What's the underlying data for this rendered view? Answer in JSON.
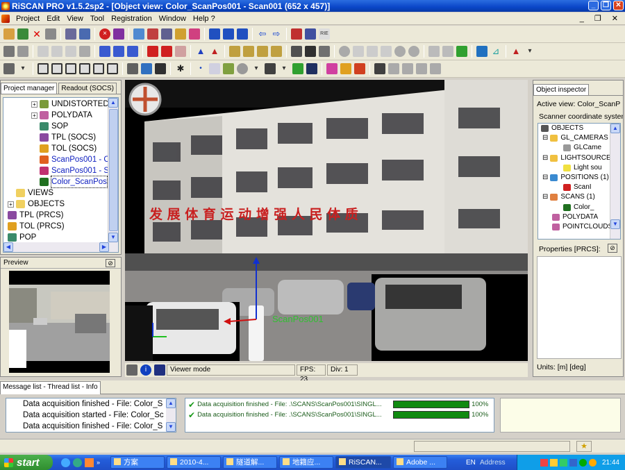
{
  "title": "RiSCAN PRO v1.5.2sp2 - [Object view: Color_ScanPos001 - Scan001 (652 x 457)]",
  "menu": [
    "Project",
    "Edit",
    "View",
    "Tool",
    "Registration",
    "Window",
    "Help ?"
  ],
  "left_panel": {
    "tabs": [
      "Project manager",
      "Readout (SOCS)"
    ],
    "tree": [
      {
        "label": "UNDISTORTED",
        "color": "#000",
        "icon": "#7a9a3a",
        "indent": 40,
        "expand": "+"
      },
      {
        "label": "POLYDATA",
        "color": "#000",
        "icon": "#c060a0",
        "indent": 40,
        "expand": "+"
      },
      {
        "label": "SOP",
        "color": "#000",
        "icon": "#3a8a6a",
        "indent": 52,
        "expand": ""
      },
      {
        "label": "TPL (SOCS)",
        "color": "#000",
        "icon": "#8a4aa0",
        "indent": 52,
        "expand": ""
      },
      {
        "label": "TOL (SOCS)",
        "color": "#000",
        "icon": "#e0a020",
        "indent": 52,
        "expand": ""
      },
      {
        "label": "ScanPos001 - C",
        "color": "#1020c0",
        "icon": "#e06020",
        "indent": 52,
        "expand": ""
      },
      {
        "label": "ScanPos001 - S",
        "color": "#1020c0",
        "icon": "#c03070",
        "indent": 52,
        "expand": ""
      },
      {
        "label": "Color_ScanPos",
        "color": "#1020c0",
        "icon": "#207020",
        "indent": 52,
        "expand": "",
        "selected": true
      },
      {
        "label": "VIEWS",
        "color": "#000",
        "icon": "#f0d060",
        "indent": 18,
        "expand": ""
      },
      {
        "label": "OBJECTS",
        "color": "#000",
        "icon": "#f0d060",
        "indent": 6,
        "expand": "+"
      },
      {
        "label": "TPL (PRCS)",
        "color": "#000",
        "icon": "#8a4aa0",
        "indent": 6,
        "expand": ""
      },
      {
        "label": "TOL (PRCS)",
        "color": "#000",
        "icon": "#e0a020",
        "indent": 6,
        "expand": ""
      },
      {
        "label": "POP",
        "color": "#000",
        "icon": "#3a8a6a",
        "indent": 6,
        "expand": ""
      }
    ],
    "preview_label": "Preview"
  },
  "viewport": {
    "banner_text": "发 展 体 育 运 动   增 强 人 民 体 质",
    "scanpos_label": "ScanPos001"
  },
  "viewer_status": {
    "mode": "Viewer mode",
    "fps": "FPS: 23",
    "div": "Div: 1"
  },
  "right_panel": {
    "tab": "Object inspector",
    "active_view": "Active view:  Color_ScanP",
    "coord_system": "Scanner coordinate system",
    "tree": [
      {
        "label": "OBJECTS",
        "indent": 4,
        "expand": "",
        "icon": "#555"
      },
      {
        "label": "GL_CAMERAS (",
        "indent": 6,
        "expand": "⊟",
        "icon": "#f0c040"
      },
      {
        "label": "GLCame",
        "indent": 36,
        "expand": "",
        "icon": "#999"
      },
      {
        "label": "LIGHTSOURCE",
        "indent": 6,
        "expand": "⊟",
        "icon": "#f0c040"
      },
      {
        "label": "Light sou",
        "indent": 36,
        "expand": "",
        "icon": "#f0e040"
      },
      {
        "label": "POSITIONS (1)",
        "indent": 6,
        "expand": "⊟",
        "icon": "#3a8ad0"
      },
      {
        "label": "ScanI",
        "indent": 36,
        "expand": "",
        "icon": "#d02020"
      },
      {
        "label": "SCANS (1)",
        "indent": 6,
        "expand": "⊟",
        "icon": "#e08040"
      },
      {
        "label": "Color_",
        "indent": 36,
        "expand": "",
        "icon": "#207020"
      },
      {
        "label": "POLYDATA",
        "indent": 20,
        "expand": "",
        "icon": "#c060a0"
      },
      {
        "label": "POINTCLOUDS",
        "indent": 20,
        "expand": "",
        "icon": "#c060a0"
      }
    ],
    "properties": "Properties [PRCS]:",
    "units": "Units: [m] [deg]"
  },
  "messages": {
    "tab": "Message list - Thread list - Info",
    "list": [
      "Data acquisition finished - File: Color_S",
      "Data acquisition started - File: Color_Sc",
      "Data acquisition finished - File: Color_S"
    ],
    "threads": [
      {
        "text": "Data acquisition finished - File: .\\SCANS\\ScanPos001\\SINGL...",
        "percent": "100%",
        "progress": 1.0
      },
      {
        "text": "Data acquisition finished - File: .\\SCANS\\ScanPos001\\SINGL...",
        "percent": "100%",
        "progress": 1.0
      }
    ]
  },
  "taskbar": {
    "start": "start",
    "tasks": [
      {
        "label": "方案",
        "w": 78
      },
      {
        "label": "2010-4...",
        "w": 78
      },
      {
        "label": "隧道解...",
        "w": 78
      },
      {
        "label": "地籍应...",
        "w": 78
      },
      {
        "label": "RiSCAN...",
        "w": 80,
        "active": true
      },
      {
        "label": "Adobe ...",
        "w": 78
      }
    ],
    "lang": "EN",
    "address": "Address",
    "clock": "21:44"
  }
}
